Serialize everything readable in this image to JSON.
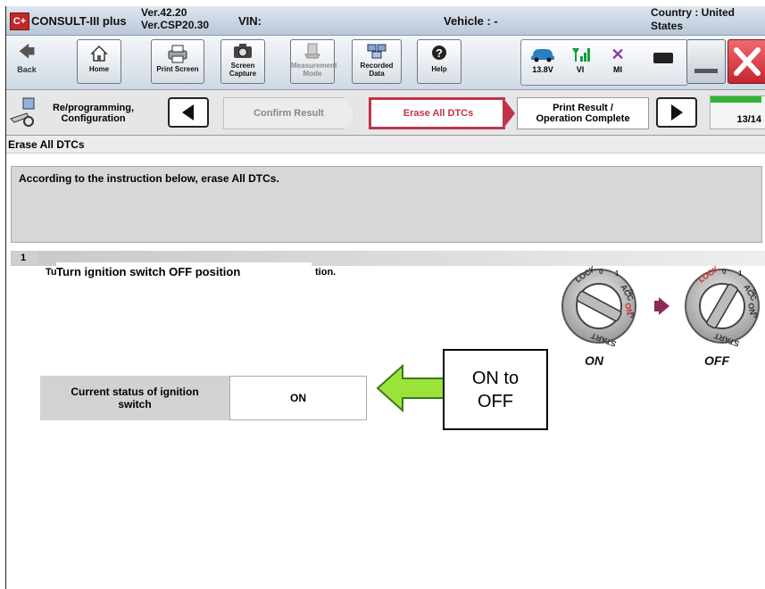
{
  "app": {
    "logo_text": "C+",
    "name": "CONSULT-III plus",
    "version_line1": "Ver.42.20",
    "version_line2": "Ver.CSP20.30",
    "vin_label": "VIN:",
    "vehicle_label": "Vehicle : -",
    "country_line1": "Country : United",
    "country_line2": "States"
  },
  "toolbar": {
    "back": "Back",
    "home": "Home",
    "print_screen": "Print Screen",
    "screen_capture_1": "Screen",
    "screen_capture_2": "Capture",
    "measurement_1": "Measurement",
    "measurement_2": "Mode",
    "recorded_1": "Recorded",
    "recorded_2": "Data",
    "help": "Help"
  },
  "status": {
    "voltage": "13.8V",
    "vi": "VI",
    "mi": "MI"
  },
  "steps": {
    "section_1": "Re/programming,",
    "section_2": "Configuration",
    "confirm_result": "Confirm Result",
    "erase_all_dtcs": "Erase All DTCs",
    "print_result_1": "Print Result /",
    "print_result_2": "Operation Complete",
    "progress": "13/14",
    "progress_fraction": 0.93
  },
  "page": {
    "title": "Erase All DTCs",
    "instruction": "According to the instruction below, erase All DTCs.",
    "step_number": "1",
    "step_text_prefix": "Tu",
    "step_text": "Turn ignition switch OFF position",
    "step_text_suffix": "tion.",
    "ignition_label_1": "Current status of ignition",
    "ignition_label_2": "switch",
    "ignition_value": "ON",
    "callout_1": "ON to",
    "callout_2": "OFF"
  },
  "key_diagram": {
    "on_label": "ON",
    "off_label": "OFF",
    "lock": "LOCK",
    "acc": "ACC",
    "on": "ON",
    "start": "START",
    "zero": "0",
    "one": "1",
    "two": "2",
    "three": "3"
  },
  "colors": {
    "active_step_border": "#c2334a",
    "active_step_text": "#c2334a",
    "progress_green": "#2fb535",
    "callout_arrow": "#9be33a",
    "close_red": "#d9363e"
  }
}
